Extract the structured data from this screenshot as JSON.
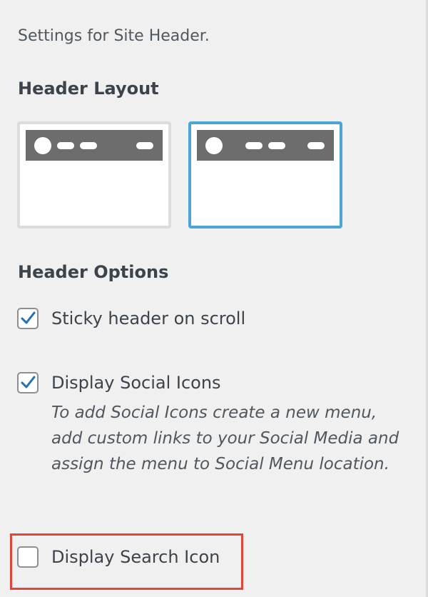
{
  "section_description": "Settings for Site Header.",
  "header_layout": {
    "title": "Header Layout",
    "options": [
      {
        "id": "left-logo",
        "selected": false
      },
      {
        "id": "centered",
        "selected": true
      }
    ]
  },
  "header_options": {
    "title": "Header Options",
    "items": [
      {
        "label": "Sticky header on scroll",
        "checked": true
      },
      {
        "label": "Display Social Icons",
        "checked": true,
        "help": "To add Social Icons create a new menu, add custom links to your Social Media and assign the menu to Social Menu location."
      },
      {
        "label": "Display Search Icon",
        "checked": false
      }
    ]
  },
  "colors": {
    "selected_border": "#4ca4d7",
    "unselected_border": "#dcdcde",
    "checkmark": "#2271b1",
    "highlight": "#e2463a",
    "panel_bg": "#f0f0f1"
  }
}
